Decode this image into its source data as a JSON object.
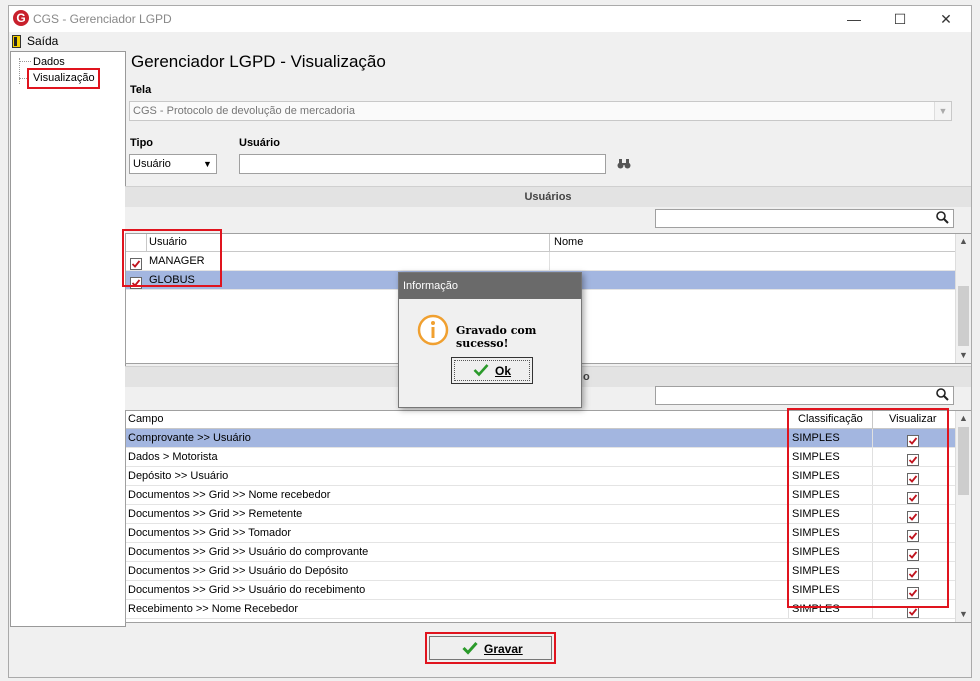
{
  "window": {
    "title": "CGS - Gerenciador LGPD",
    "minimize": "—",
    "maximize": "☐",
    "close": "✕"
  },
  "menu": {
    "saida": "Saída"
  },
  "tree": {
    "items": [
      "Dados",
      "Visualização"
    ]
  },
  "page": {
    "title": "Gerenciador LGPD - Visualização"
  },
  "tela": {
    "label": "Tela",
    "value": "CGS - Protocolo de devolução de mercadoria"
  },
  "tipo": {
    "label": "Tipo",
    "value": "Usuário"
  },
  "usuario_filter": {
    "label": "Usuário",
    "value": ""
  },
  "usuarios": {
    "section_title": "Usuários",
    "search_value": "",
    "columns": [
      "Usuário",
      "Nome"
    ],
    "rows": [
      {
        "usuario": "MANAGER",
        "nome": "",
        "checked": true,
        "selected": false
      },
      {
        "usuario": "GLOBUS",
        "nome": "",
        "checked": true,
        "selected": true
      }
    ]
  },
  "campos": {
    "section_title_visible": "o",
    "search_value": "",
    "columns": [
      "Campo",
      "Classificação",
      "Visualizar"
    ],
    "rows": [
      {
        "campo": "Comprovante >> Usuário",
        "classificacao": "SIMPLES",
        "visualizar": true,
        "selected": true
      },
      {
        "campo": "Dados > Motorista",
        "classificacao": "SIMPLES",
        "visualizar": true,
        "selected": false
      },
      {
        "campo": "Depósito >> Usuário",
        "classificacao": "SIMPLES",
        "visualizar": true,
        "selected": false
      },
      {
        "campo": "Documentos >> Grid >> Nome recebedor",
        "classificacao": "SIMPLES",
        "visualizar": true,
        "selected": false
      },
      {
        "campo": "Documentos >> Grid >> Remetente",
        "classificacao": "SIMPLES",
        "visualizar": true,
        "selected": false
      },
      {
        "campo": "Documentos >> Grid >> Tomador",
        "classificacao": "SIMPLES",
        "visualizar": true,
        "selected": false
      },
      {
        "campo": "Documentos >> Grid >> Usuário do comprovante",
        "classificacao": "SIMPLES",
        "visualizar": true,
        "selected": false
      },
      {
        "campo": "Documentos >> Grid >> Usuário do Depósito",
        "classificacao": "SIMPLES",
        "visualizar": true,
        "selected": false
      },
      {
        "campo": "Documentos >> Grid >> Usuário do recebimento",
        "classificacao": "SIMPLES",
        "visualizar": true,
        "selected": false
      },
      {
        "campo": "Recebimento >> Nome Recebedor",
        "classificacao": "SIMPLES",
        "visualizar": true,
        "selected": false
      }
    ]
  },
  "dialog": {
    "title": "Informação",
    "message": "Gravado com sucesso!",
    "ok_label": "Ok"
  },
  "footer": {
    "gravar_label": "Gravar"
  },
  "colors": {
    "selection": "#a3b6e0",
    "highlight_border": "#e0141e",
    "info_icon": "#f0a030",
    "check": "#c0141e",
    "ok_check": "#2a9a2a"
  }
}
